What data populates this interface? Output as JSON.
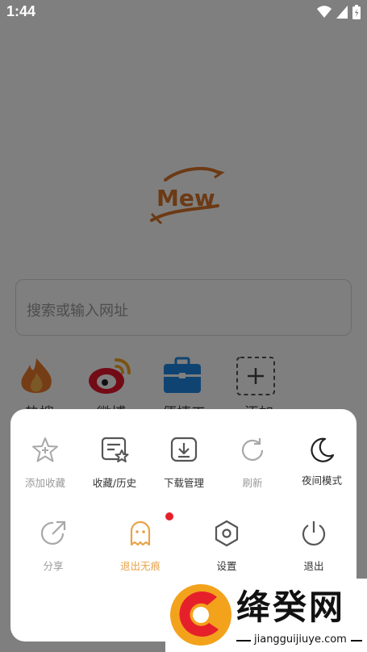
{
  "status": {
    "time": "1:44"
  },
  "brand": {
    "logo_text": "Mew"
  },
  "search": {
    "placeholder": "搜索或输入网址"
  },
  "shortcuts": [
    {
      "label": "热搜",
      "icon": "flame-icon"
    },
    {
      "label": "微博",
      "icon": "weibo-icon"
    },
    {
      "label": "便捷工具",
      "icon": "toolbox-icon"
    },
    {
      "label": "添加",
      "icon": "add-icon"
    }
  ],
  "menu": {
    "row1": [
      {
        "label": "添加收藏",
        "icon": "star-plus-icon",
        "state": "disabled"
      },
      {
        "label": "收藏/历史",
        "icon": "bookmark-history-icon",
        "state": "normal"
      },
      {
        "label": "下载管理",
        "icon": "download-icon",
        "state": "normal"
      },
      {
        "label": "刷新",
        "icon": "refresh-icon",
        "state": "disabled"
      },
      {
        "label": "夜间模式",
        "icon": "moon-icon",
        "state": "normal"
      }
    ],
    "row2": [
      {
        "label": "分享",
        "icon": "share-icon",
        "state": "disabled"
      },
      {
        "label": "退出无痕",
        "icon": "ghost-icon",
        "state": "active"
      },
      {
        "label": "设置",
        "icon": "settings-hexagon-icon",
        "state": "normal"
      },
      {
        "label": "退出",
        "icon": "power-icon",
        "state": "normal"
      }
    ]
  },
  "watermark": {
    "title": "绛癸网",
    "url": "jiangguijiuye.com"
  },
  "colors": {
    "accent": "#e8a34a",
    "logo": "#d8742a",
    "weibo": "#e6162d",
    "tool": "#1e88e5",
    "badge": "#e6202a"
  }
}
